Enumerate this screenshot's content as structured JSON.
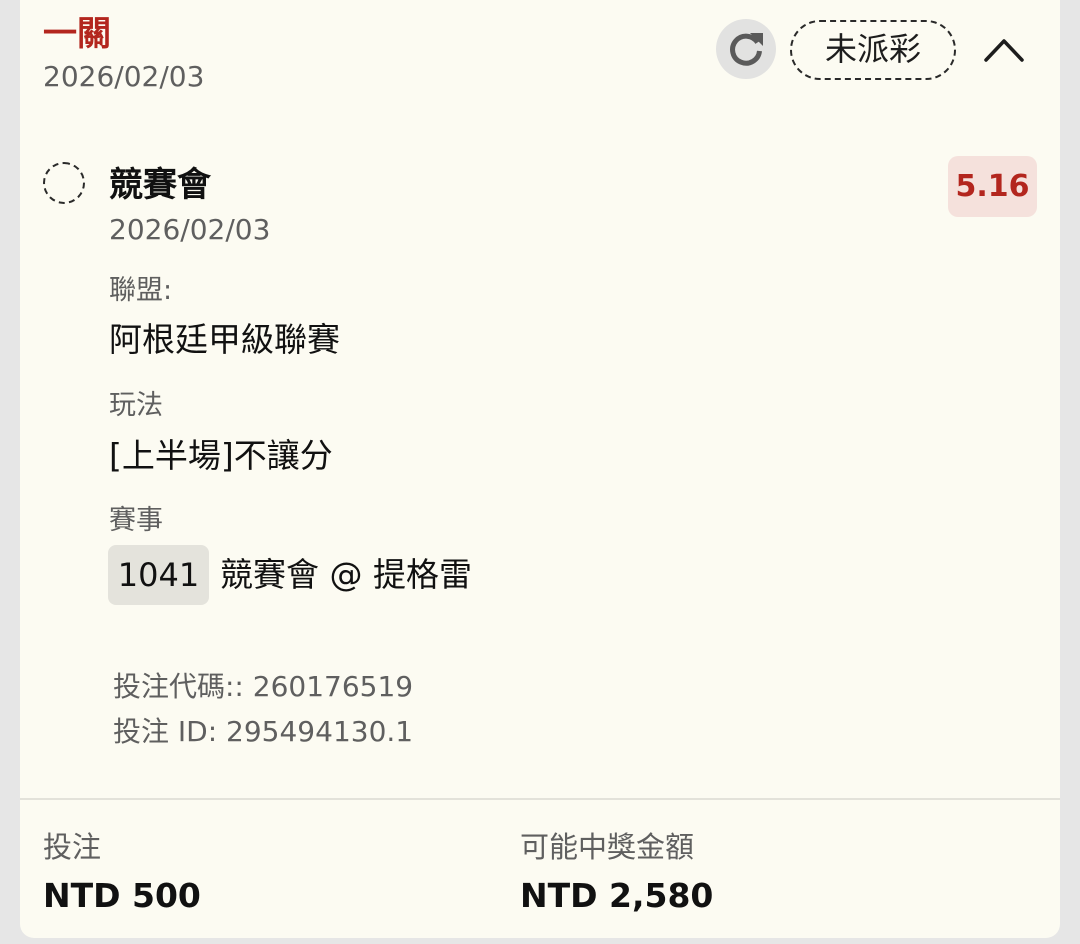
{
  "header": {
    "bet_type": "一關",
    "date": "2026/02/03",
    "status": "未派彩",
    "refresh_icon": "refresh-icon",
    "collapse_icon": "chevron-up-icon"
  },
  "selection": {
    "team": "競賽會",
    "date": "2026/02/03",
    "odds": "5.16",
    "league_label": "聯盟:",
    "league_value": "阿根廷甲級聯賽",
    "market_label": "玩法",
    "market_value": "[上半場]不讓分",
    "event_label": "賽事",
    "event_id": "1041",
    "event_name": "競賽會 @ 提格雷"
  },
  "meta": {
    "bet_code": "投注代碼:: 260176519",
    "bet_id": "投注 ID: 295494130.1"
  },
  "footer": {
    "stake_label": "投注",
    "stake_value": "NTD 500",
    "payout_label": "可能中獎金額",
    "payout_value": "NTD 2,580"
  },
  "colors": {
    "accent_red": "#b3261e",
    "card_bg": "#fcfbf2",
    "odds_bg": "#f5e1dc"
  }
}
